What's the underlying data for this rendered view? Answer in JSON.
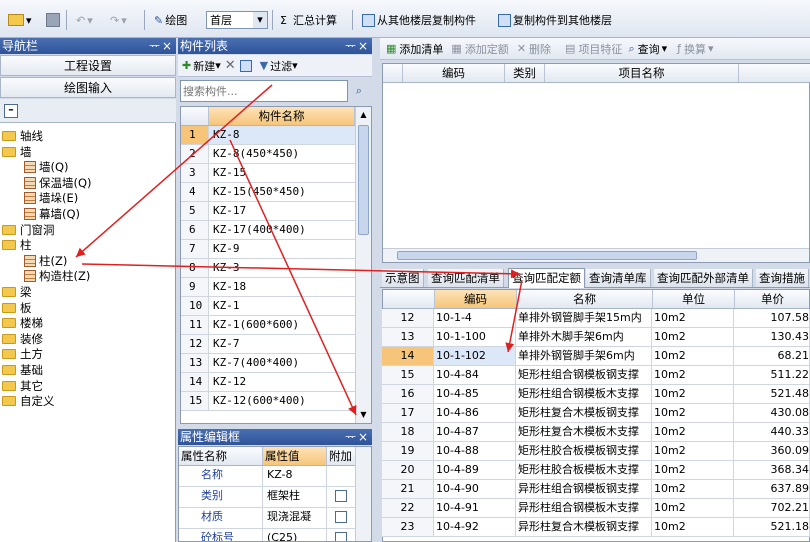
{
  "toolbar": {
    "draw_label": "绘图",
    "floor_value": "首层",
    "sum_label": "汇总计算",
    "copy_from_label": "从其他楼层复制构件",
    "copy_to_label": "复制构件到其他楼层"
  },
  "nav": {
    "title": "导航栏",
    "pin": "ᅲ",
    "close": "×",
    "project_settings": "工程设置",
    "draw_input": "绘图输入",
    "tree": [
      {
        "label": "轴线",
        "level": 0
      },
      {
        "label": "墙",
        "level": 0
      },
      {
        "label": "墙(Q)",
        "level": 1
      },
      {
        "label": "保温墙(Q)",
        "level": 1
      },
      {
        "label": "墙垛(E)",
        "level": 1
      },
      {
        "label": "幕墙(Q)",
        "level": 1
      },
      {
        "label": "门窗洞",
        "level": 0
      },
      {
        "label": "柱",
        "level": 0
      },
      {
        "label": "柱(Z)",
        "level": 1
      },
      {
        "label": "构造柱(Z)",
        "level": 1
      },
      {
        "label": "梁",
        "level": 0
      },
      {
        "label": "板",
        "level": 0
      },
      {
        "label": "楼梯",
        "level": 0
      },
      {
        "label": "装修",
        "level": 0
      },
      {
        "label": "土方",
        "level": 0
      },
      {
        "label": "基础",
        "level": 0
      },
      {
        "label": "其它",
        "level": 0
      },
      {
        "label": "自定义",
        "level": 0
      }
    ]
  },
  "components": {
    "title": "构件列表",
    "new_label": "新建",
    "filter_label": "过滤",
    "search_placeholder": "搜索构件...",
    "col_header": "构件名称",
    "rows": [
      {
        "n": "1",
        "name": "KZ-8"
      },
      {
        "n": "2",
        "name": "KZ-8(450*450)"
      },
      {
        "n": "3",
        "name": "KZ-15"
      },
      {
        "n": "4",
        "name": "KZ-15(450*450)"
      },
      {
        "n": "5",
        "name": "KZ-17"
      },
      {
        "n": "6",
        "name": "KZ-17(400*400)"
      },
      {
        "n": "7",
        "name": "KZ-9"
      },
      {
        "n": "8",
        "name": "KZ-3"
      },
      {
        "n": "9",
        "name": "KZ-18"
      },
      {
        "n": "10",
        "name": "KZ-1"
      },
      {
        "n": "11",
        "name": "KZ-1(600*600)"
      },
      {
        "n": "12",
        "name": "KZ-7"
      },
      {
        "n": "13",
        "name": "KZ-7(400*400)"
      },
      {
        "n": "14",
        "name": "KZ-12"
      },
      {
        "n": "15",
        "name": "KZ-12(600*400)"
      }
    ]
  },
  "props": {
    "title": "属性编辑框",
    "col_name": "属性名称",
    "col_value": "属性值",
    "col_extra": "附加",
    "rows": [
      {
        "name": "名称",
        "value": "KZ-8"
      },
      {
        "name": "类别",
        "value": "框架柱"
      },
      {
        "name": "材质",
        "value": "现浇混凝"
      },
      {
        "name": "砼标号",
        "value": "(C25)"
      }
    ]
  },
  "right_toolbar": {
    "add_list": "添加清单",
    "add_quota": "添加定额",
    "delete": "删除",
    "feature": "项目特征",
    "query": "查询",
    "convert": "换算"
  },
  "upper_grid": {
    "col_code": "编码",
    "col_type": "类别",
    "col_name": "项目名称"
  },
  "tabs": [
    "示意图",
    "查询匹配清单",
    "查询匹配定额",
    "查询清单库",
    "查询匹配外部清单",
    "查询措施"
  ],
  "quota": {
    "col_code": "编码",
    "col_name": "名称",
    "col_unit": "单位",
    "col_price": "单价",
    "rows": [
      {
        "n": "12",
        "code": "10-1-4",
        "name": "单排外钢管脚手架15m内",
        "unit": "10m2",
        "price": "107.58"
      },
      {
        "n": "13",
        "code": "10-1-100",
        "name": "单排外木脚手架6m内",
        "unit": "10m2",
        "price": "130.43"
      },
      {
        "n": "14",
        "code": "10-1-102",
        "name": "单排外钢管脚手架6m内",
        "unit": "10m2",
        "price": "68.21"
      },
      {
        "n": "15",
        "code": "10-4-84",
        "name": "矩形柱组合钢模板钢支撑",
        "unit": "10m2",
        "price": "511.22"
      },
      {
        "n": "16",
        "code": "10-4-85",
        "name": "矩形柱组合钢模板木支撑",
        "unit": "10m2",
        "price": "521.48"
      },
      {
        "n": "17",
        "code": "10-4-86",
        "name": "矩形柱复合木模板钢支撑",
        "unit": "10m2",
        "price": "430.08"
      },
      {
        "n": "18",
        "code": "10-4-87",
        "name": "矩形柱复合木模板木支撑",
        "unit": "10m2",
        "price": "440.33"
      },
      {
        "n": "19",
        "code": "10-4-88",
        "name": "矩形柱胶合板模板钢支撑",
        "unit": "10m2",
        "price": "360.09"
      },
      {
        "n": "20",
        "code": "10-4-89",
        "name": "矩形柱胶合板模板木支撑",
        "unit": "10m2",
        "price": "368.34"
      },
      {
        "n": "21",
        "code": "10-4-90",
        "name": "异形柱组合钢模板钢支撑",
        "unit": "10m2",
        "price": "637.89"
      },
      {
        "n": "22",
        "code": "10-4-91",
        "name": "异形柱组合钢模板木支撑",
        "unit": "10m2",
        "price": "702.21"
      },
      {
        "n": "23",
        "code": "10-4-92",
        "name": "异形柱复合木模板钢支撑",
        "unit": "10m2",
        "price": "521.18"
      }
    ]
  },
  "colors": {
    "highlight": "#f6c57a",
    "selected_row": "#dce8f8",
    "title_bar": "#2f539a",
    "arrow": "#e02020"
  }
}
